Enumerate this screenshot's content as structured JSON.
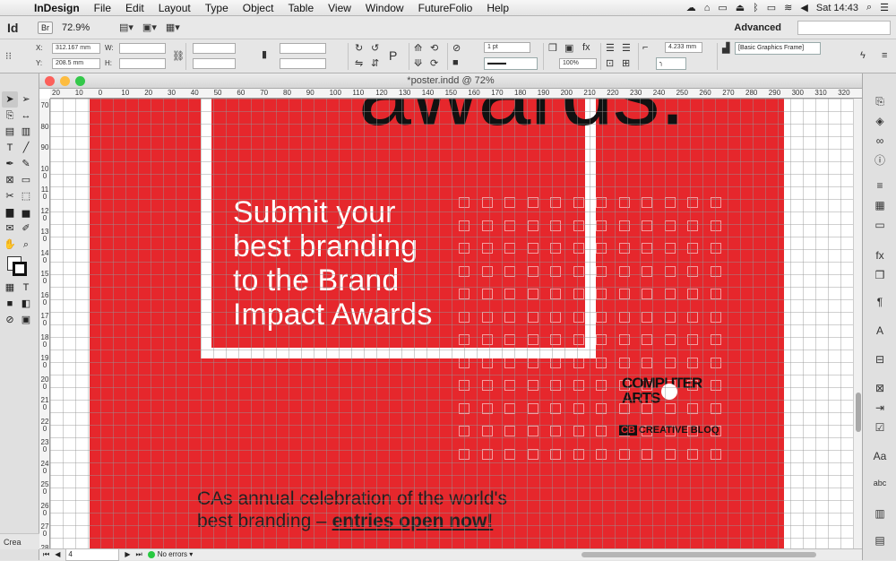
{
  "menubar": {
    "app_name": "InDesign",
    "items": [
      "File",
      "Edit",
      "Layout",
      "Type",
      "Object",
      "Table",
      "View",
      "Window",
      "FutureFolio",
      "Help"
    ],
    "clock": "Sat 14:43"
  },
  "app_bar": {
    "logo": "Id",
    "bridge": "Br",
    "zoom": "72.9%",
    "workspace": "Advanced"
  },
  "control_panel": {
    "x_label": "X:",
    "x_value": "312.167 mm",
    "y_label": "Y:",
    "y_value": "208.5 mm",
    "w_label": "W:",
    "h_label": "H:",
    "stroke_weight": "1 pt",
    "scale_value": "100%",
    "dimension_value": "4.233 mm",
    "object_style": "[Basic Graphics Frame]"
  },
  "document": {
    "title": "*poster.indd @ 72%",
    "ruler_top": [
      "20",
      "10",
      "0",
      "10",
      "20",
      "30",
      "40",
      "50",
      "60",
      "70",
      "80",
      "90",
      "100",
      "110",
      "120",
      "130",
      "140",
      "150",
      "160",
      "170",
      "180",
      "190",
      "200",
      "210",
      "220",
      "230",
      "240",
      "250",
      "260",
      "270",
      "280",
      "290",
      "300",
      "310",
      "320"
    ],
    "ruler_left": [
      "70",
      "80",
      "90",
      "100",
      "110",
      "120",
      "130",
      "140",
      "150",
      "160",
      "170",
      "180",
      "190",
      "200",
      "210",
      "220",
      "230",
      "240",
      "250",
      "260",
      "270",
      "280"
    ],
    "headline_partial": "awards.",
    "submit_lines": [
      "Submit your",
      "best branding",
      "to the Brand",
      "Impact Awards"
    ],
    "logo_computer_arts": "COMPUTER ARTS",
    "logo_creative_bloq": "CREATIVE BLOQ",
    "logo_cb": "CB",
    "bottom_line1": "CAs annual celebration of the world's",
    "bottom_line2_normal": "best branding – ",
    "bottom_line2_bold": "entries open now!"
  },
  "status_bar": {
    "page_number": "4",
    "preflight": "No errors"
  },
  "left_panel": {
    "create_label": "Crea"
  },
  "colors": {
    "poster_red": "#e6272c",
    "preflight_ok": "#28c940"
  }
}
